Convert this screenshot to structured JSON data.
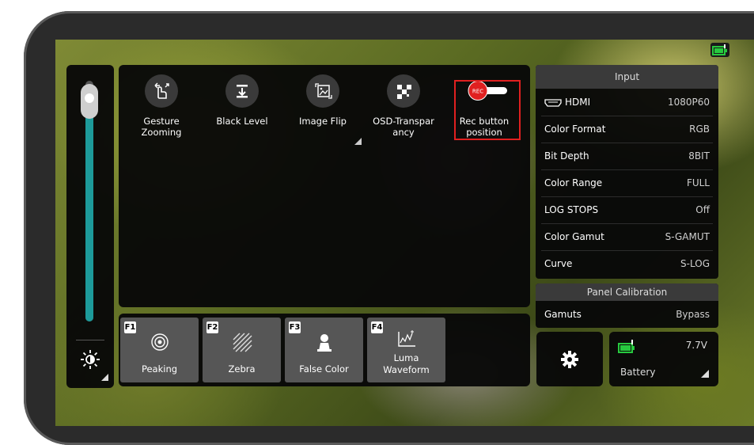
{
  "menu": {
    "items": [
      {
        "label": "Gesture\nZooming",
        "icon": "gesture-zoom-icon"
      },
      {
        "label": "Black Level",
        "icon": "black-level-icon"
      },
      {
        "label": "Image Flip",
        "icon": "image-flip-icon"
      },
      {
        "label": "OSD-Transpar\nancy",
        "icon": "osd-transparency-icon"
      },
      {
        "label": "Rec button\nposition",
        "icon": "rec-toggle-icon",
        "badge": "REC"
      }
    ]
  },
  "brightness": {
    "level": 0.92,
    "icon": "brightness-icon"
  },
  "fkeys": [
    {
      "num": "F1",
      "label": "Peaking",
      "icon": "peaking-icon"
    },
    {
      "num": "F2",
      "label": "Zebra",
      "icon": "zebra-icon"
    },
    {
      "num": "F3",
      "label": "False Color",
      "icon": "false-color-icon"
    },
    {
      "num": "F4",
      "label": "Luma\nWaveform",
      "icon": "waveform-icon"
    }
  ],
  "input": {
    "title": "Input",
    "rows": [
      {
        "key": "HDMI",
        "value": "1080P60"
      },
      {
        "key": "Color Format",
        "value": "RGB"
      },
      {
        "key": "Bit Depth",
        "value": "8BIT"
      },
      {
        "key": "Color Range",
        "value": "FULL"
      },
      {
        "key": "LOG STOPS",
        "value": "Off"
      },
      {
        "key": "Color Gamut",
        "value": "S-GAMUT"
      },
      {
        "key": "Curve",
        "value": "S-LOG"
      }
    ]
  },
  "calibration": {
    "title": "Panel Calibration",
    "key": "Gamuts",
    "value": "Bypass"
  },
  "battery": {
    "voltage": "7.7V",
    "label": "Battery"
  },
  "colors": {
    "accent": "#1d9a9a",
    "rec_red": "#e02020",
    "battery_green": "#27c93f"
  }
}
